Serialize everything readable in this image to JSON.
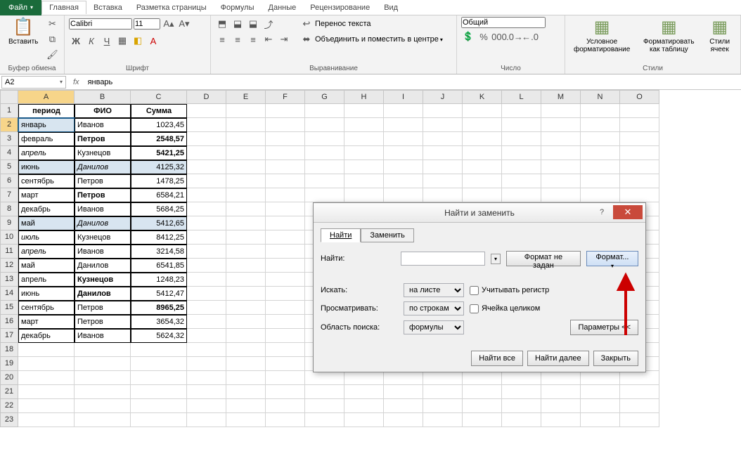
{
  "tabs": {
    "file": "Файл",
    "items": [
      "Главная",
      "Вставка",
      "Разметка страницы",
      "Формулы",
      "Данные",
      "Рецензирование",
      "Вид"
    ],
    "active": 0
  },
  "ribbon": {
    "clipboard": {
      "paste": "Вставить",
      "label": "Буфер обмена"
    },
    "font": {
      "name": "Calibri",
      "size": "11",
      "buttons": [
        "Ж",
        "К",
        "Ч"
      ],
      "label": "Шрифт"
    },
    "alignment": {
      "wrap": "Перенос текста",
      "merge": "Объединить и поместить в центре",
      "label": "Выравнивание"
    },
    "number": {
      "format": "Общий",
      "label": "Число"
    },
    "styles": {
      "cond": "Условное форматирование",
      "table": "Форматировать как таблицу",
      "cell": "Стили ячеек",
      "label": "Стили"
    }
  },
  "namebox": "A2",
  "fx": "fx",
  "formula_value": "январь",
  "columns": [
    "A",
    "B",
    "C",
    "D",
    "E",
    "F",
    "G",
    "H",
    "I",
    "J",
    "K",
    "L",
    "M",
    "N",
    "O"
  ],
  "headers": [
    "период",
    "ФИО",
    "Сумма"
  ],
  "rows": [
    {
      "n": 1,
      "a": "период",
      "b": "ФИО",
      "c": "Сумма",
      "hdr": true
    },
    {
      "n": 2,
      "a": "январь",
      "b": "Иванов",
      "c": "1023,45",
      "sel": true
    },
    {
      "n": 3,
      "a": "февраль",
      "b": "Петров",
      "c": "2548,57",
      "bbold": true,
      "cbold": true
    },
    {
      "n": 4,
      "a": "апрель",
      "b": "Кузнецов",
      "c": "5421,25",
      "aital": true,
      "cbold": true
    },
    {
      "n": 5,
      "a": "июнь",
      "b": "Данилов",
      "c": "4125,32",
      "hl": true,
      "bital": true
    },
    {
      "n": 6,
      "a": "сентябрь",
      "b": "Петров",
      "c": "1478,25"
    },
    {
      "n": 7,
      "a": "март",
      "b": "Петров",
      "c": "6584,21",
      "bbold": true
    },
    {
      "n": 8,
      "a": "декабрь",
      "b": "Иванов",
      "c": "5684,25"
    },
    {
      "n": 9,
      "a": "май",
      "b": "Данилов",
      "c": "5412,65",
      "hl": true,
      "bital": true
    },
    {
      "n": 10,
      "a": "июль",
      "b": "Кузнецов",
      "c": "8412,25",
      "aital": true
    },
    {
      "n": 11,
      "a": "апрель",
      "b": "Иванов",
      "c": "3214,58",
      "aital": true
    },
    {
      "n": 12,
      "a": "май",
      "b": "Данилов",
      "c": "6541,85"
    },
    {
      "n": 13,
      "a": "апрель",
      "b": "Кузнецов",
      "c": "1248,23",
      "bbold": true
    },
    {
      "n": 14,
      "a": "июнь",
      "b": "Данилов",
      "c": "5412,47",
      "bbold": true
    },
    {
      "n": 15,
      "a": "сентябрь",
      "b": "Петров",
      "c": "8965,25",
      "cbold": true
    },
    {
      "n": 16,
      "a": "март",
      "b": "Петров",
      "c": "3654,32"
    },
    {
      "n": 17,
      "a": "декабрь",
      "b": "Иванов",
      "c": "5624,32"
    }
  ],
  "empty_rows": [
    18,
    19,
    20,
    21,
    22,
    23
  ],
  "dialog": {
    "title": "Найти и заменить",
    "tabs": {
      "find": "Найти",
      "replace": "Заменить"
    },
    "find_label": "Найти:",
    "format_not_set": "Формат не задан",
    "format_btn": "Формат...",
    "search_in_label": "Искать:",
    "search_in_value": "на листе",
    "search_by_label": "Просматривать:",
    "search_by_value": "по строкам",
    "lookin_label": "Область поиска:",
    "lookin_value": "формулы",
    "match_case": "Учитывать регистр",
    "match_whole": "Ячейка целиком",
    "options_btn": "Параметры <<",
    "find_all": "Найти все",
    "find_next": "Найти далее",
    "close": "Закрыть"
  }
}
